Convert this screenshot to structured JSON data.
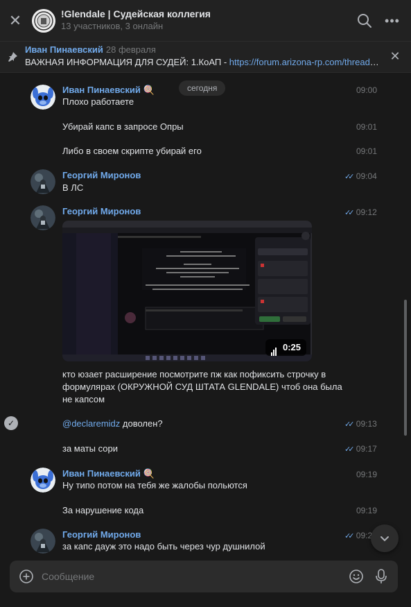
{
  "header": {
    "title": "!Glendale | Судейская коллегия",
    "subtitle": "13 участников, 3 онлайн"
  },
  "pinned": {
    "author": "Иван Пинаевский",
    "date": "28 февраля",
    "text": "ВАЖНАЯ ИНФОРМАЦИЯ ДЛЯ СУДЕЙ: 1.КоАП - ",
    "link": "https://forum.arizona-rp.com/threads..."
  },
  "date_chip": "сегодня",
  "messages": [
    {
      "author": "Иван Пинаевский",
      "emoji": "🍭",
      "text": "Плохо работаете",
      "time": "09:00"
    },
    {
      "text": "Убирай капс в запросе Опры",
      "time": "09:01"
    },
    {
      "text": "Либо в своем скрипте убирай его",
      "time": "09:01"
    },
    {
      "author": "Георгий Миронов",
      "text": "В ЛС",
      "time": "09:04"
    },
    {
      "author": "Георгий Миронов",
      "time": "09:12",
      "video_duration": "0:25",
      "text": "кто юзает расширение посмотрите пж как пофиксить строчку в формулярах (ОКРУЖНОЙ СУД ШТАТА GLENDALE) чтоб она была не капсом"
    },
    {
      "mention": "@declaremidz",
      "text": " доволен?",
      "time": "09:13"
    },
    {
      "text": "за маты сори",
      "time": "09:17"
    },
    {
      "author": "Иван Пинаевский",
      "emoji": "🍭",
      "text": "Ну типо потом на тебя же жалобы польются",
      "time": "09:19"
    },
    {
      "text": "За нарушение кода",
      "time": "09:19"
    },
    {
      "author": "Георгий Миронов",
      "text": "за капс дауж это надо быть через чур душнилой",
      "time": "09:2"
    }
  ],
  "composer": {
    "placeholder": "Сообщение"
  },
  "colors": {
    "background": "#191919",
    "panel": "#222222",
    "accent": "#71aaeb",
    "muted": "#76787a"
  },
  "icons": [
    "close-icon",
    "search-icon",
    "more-icon",
    "pin-icon",
    "check-icon",
    "chevron-down-icon",
    "plus-icon",
    "emoji-icon",
    "mic-icon"
  ]
}
